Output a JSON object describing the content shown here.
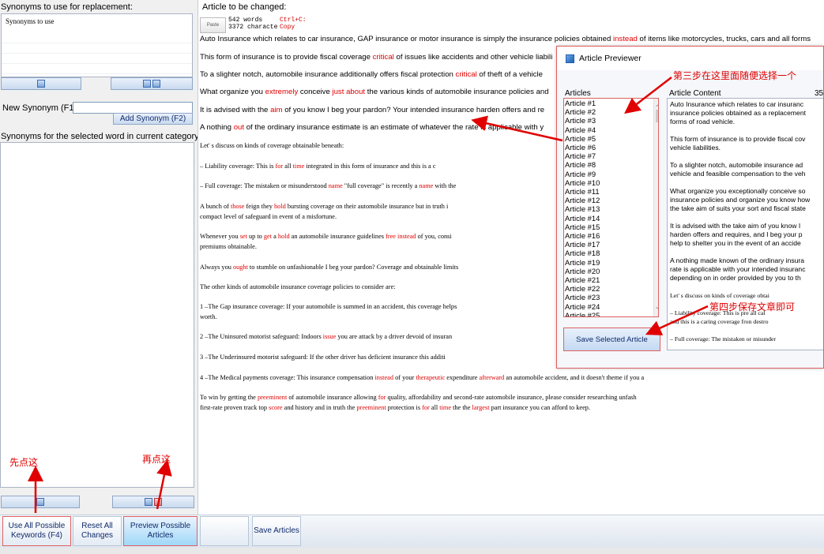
{
  "left": {
    "synonyms_label": "Synonyms to use for replacement:",
    "synonyms_placeholder": "Synonyms to use",
    "new_synonym_label": "New Synonym (F1):",
    "new_synonym_value": "",
    "add_synonym_label": "Add Synonym (F2)",
    "category_label": "Synonyms for the selected word in current category:"
  },
  "article": {
    "title": "Article to be changed:",
    "paste_label": "Paste",
    "word_count": "542 words",
    "char_count": "3372 characte",
    "shortcut": "Ctrl+C:",
    "copy_label": "Copy",
    "paragraphs": [
      "Auto Insurance which relates to car insurance, GAP insurance or motor insurance is simply the insurance policies obtained ",
      "instead",
      " of items like motorcycles, trucks, cars and all forms",
      "This form of insurance is to provide fiscal coverage ",
      "critical",
      " of issues like accidents and other vehicle liabili",
      "To a slighter notch, automobile insurance additionally offers fiscal protection ",
      "critical",
      " of theft of a vehicle",
      "What organize you ",
      "extremely",
      " conceive ",
      "just about",
      " the various kinds of automobile insurance policies and",
      "It is advised with the ",
      "aim",
      " of you know I beg your pardon? Your intended insurance harden offers and re",
      "A nothing ",
      "out",
      " of the ordinary insurance estimate is an estimate of whatever the rate is applicable with y"
    ],
    "mono": {
      "l1": "Let' s discuss on kinds of coverage obtainable beneath:",
      "l2a": "– Liability coverage: This is ",
      "l2b": "for",
      "l2c": " all ",
      "l2d": "time",
      "l2e": " integrated in this form of insurance and this is a c",
      "l3a": "– Full coverage: The mistaken or misunderstood ",
      "l3b": "name",
      "l3c": " \"full coverage\" is recently a ",
      "l3d": "name",
      "l3e": " with the",
      "l4a": "A bunch of ",
      "l4b": "those",
      "l4c": " feign they ",
      "l4d": "hold",
      "l4e": " bursting coverage on their automobile insurance but in truth i",
      "l4f": "compact level of safeguard in event of a misfortune.",
      "l5a": "Whenever you ",
      "l5b": "set",
      "l5c": " up to ",
      "l5d": "get",
      "l5e": " a ",
      "l5f": "hold",
      "l5g": " an automobile insurance guidelines ",
      "l5h": "free instead",
      "l5i": " of you, consi",
      "l5j": "premiums obtainable.",
      "l6a": "Always you ",
      "l6b": "ought",
      "l6c": " to stumble on unfashionable I beg your pardon? Coverage and obtainable limits",
      "l7": "The other kinds of automobile insurance coverage policies to consider are:",
      "l8a": "1 –The Gap insurance coverage: If your automobile is summed in an accident, this coverage helps",
      "l8b": "worth.",
      "l9a": "2 –The Uninsured motorist safeguard: Indoors ",
      "l9b": "issue",
      "l9c": " you are attack by a driver devoid of insuran",
      "l10": "3 –The Underinsured motorist safeguard: If the other driver has deficient insurance this additi",
      "l11a": "4 –The Medical payments coverage: This insurance compensation ",
      "l11b": "instead",
      "l11c": " of your ",
      "l11d": "therapeutic",
      "l11e": " expenditure ",
      "l11f": "afterward",
      "l11g": " an automobile accident, and it doesn't theme if you a",
      "l12a": "To win by getting the ",
      "l12b": "preeminent",
      "l12c": " of automobile insurance allowing ",
      "l12d": "for",
      "l12e": " quality, affordability and second-rate automobile insurance, please consider researching unfash",
      "l13a": "first-rate proven track top ",
      "l13b": "score",
      "l13c": " and history and in truth the ",
      "l13d": "preeminent",
      "l13e": " protection is ",
      "l13f": "for",
      "l13g": " all ",
      "l13h": "time",
      "l13i": " the the ",
      "l13j": "largest",
      "l13k": " part insurance you can afford to keep."
    }
  },
  "previewer": {
    "title": "Article Previewer",
    "articles_label": "Articles",
    "content_label": "Article Content",
    "content_number": "35",
    "articles": [
      "Article #1",
      "Article #2",
      "Article #3",
      "Article #4",
      "Article #5",
      "Article #6",
      "Article #7",
      "Article #8",
      "Article #9",
      "Article #10",
      "Article #11",
      "Article #12",
      "Article #13",
      "Article #14",
      "Article #15",
      "Article #16",
      "Article #17",
      "Article #18",
      "Article #19",
      "Article #20",
      "Article #21",
      "Article #22",
      "Article #23",
      "Article #24",
      "Article #25"
    ],
    "content": {
      "p1a": "Auto Insurance which relates to car insuranc",
      "p1b": "insurance policies obtained as a replacement",
      "p1c": "forms of road vehicle.",
      "p2a": "This form of insurance is to provide fiscal cov",
      "p2b": "vehicle liabilities.",
      "p3a": "To a slighter notch, automobile insurance ad",
      "p3b": "vehicle and feasible compensation to the veh",
      "p4a": "What organize you exceptionally conceive so",
      "p4b": "insurance policies and organize you know how",
      "p4c": "the take aim of suits your sort and fiscal state",
      "p5a": "It is advised with the take aim of you know I",
      "p5b": "harden offers and requires, and I beg your p",
      "p5c": "help to shelter you in the event of an accide",
      "p6a": "A nothing made known of the ordinary insura",
      "p6b": "rate is applicable with your intended insuranc",
      "p6c": "depending on in order provided by you to th",
      "p7": "Let' s discuss on kinds of coverage obtai",
      "p8a": "– Liability coverage: This is pre all cal",
      "p8b": "and this is a caring coverage fron destro",
      "p9": "– Full coverage: The mistaken or misunder"
    },
    "save_selected_label": "Save Selected Article"
  },
  "toolbar": {
    "use_all_label": "Use All Possible Keywords (F4)",
    "reset_label": "Reset All Changes",
    "preview_label": "Preview Possible Articles",
    "save_label": "Save Articles"
  },
  "annotations": {
    "step1": "先点这",
    "step2": "再点这",
    "step3": "第三步在这里面随便选择一个",
    "step4": "第四步保存文章即可"
  },
  "colors": {
    "highlight": "#e00000",
    "annotation": "#e00000",
    "button_text": "#102a6b"
  }
}
